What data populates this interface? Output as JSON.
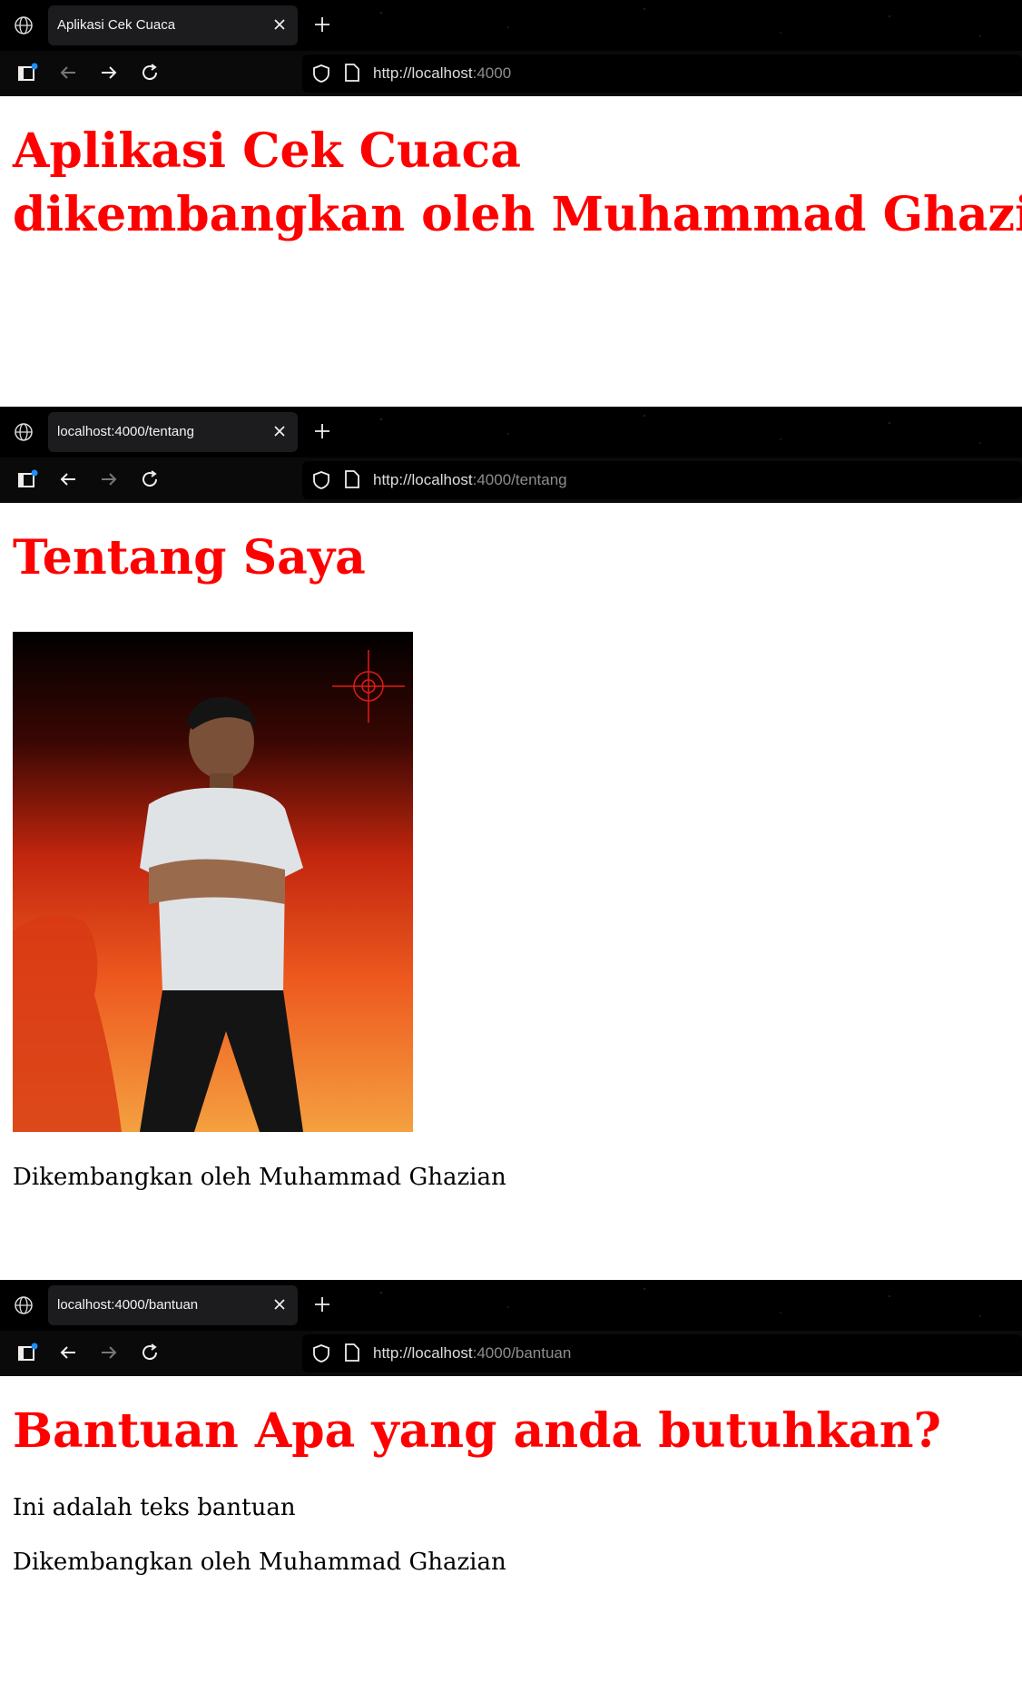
{
  "windows": [
    {
      "tab_title": "Aplikasi Cek Cuaca",
      "url_host": "http://localhost",
      "url_port_path": ":4000",
      "headings": [
        "Aplikasi Cek Cuaca",
        "dikembangkan oleh Muhammad Ghazian"
      ]
    },
    {
      "tab_title": "localhost:4000/tentang",
      "url_host": "http://localhost",
      "url_port_path": ":4000/tentang",
      "heading": "Tentang Saya",
      "photo_alt": "profile-photo",
      "footer": "Dikembangkan oleh Muhammad Ghazian"
    },
    {
      "tab_title": "localhost:4000/bantuan",
      "url_host": "http://localhost",
      "url_port_path": ":4000/bantuan",
      "heading": "Bantuan Apa yang anda butuhkan?",
      "body": "Ini adalah teks bantuan",
      "footer": "Dikembangkan oleh Muhammad Ghazian"
    }
  ],
  "icons": {
    "tab_globe": "globe-icon",
    "tab_close": "close-icon",
    "new_tab": "plus-icon",
    "sidebar": "sidebar-icon",
    "back": "arrow-left-icon",
    "forward": "arrow-right-icon",
    "reload": "reload-icon",
    "shield": "shield-icon",
    "page": "page-icon"
  },
  "colors": {
    "heading": "#ff0000",
    "chrome_bg": "#000000",
    "accent_dot": "#1e90ff"
  }
}
